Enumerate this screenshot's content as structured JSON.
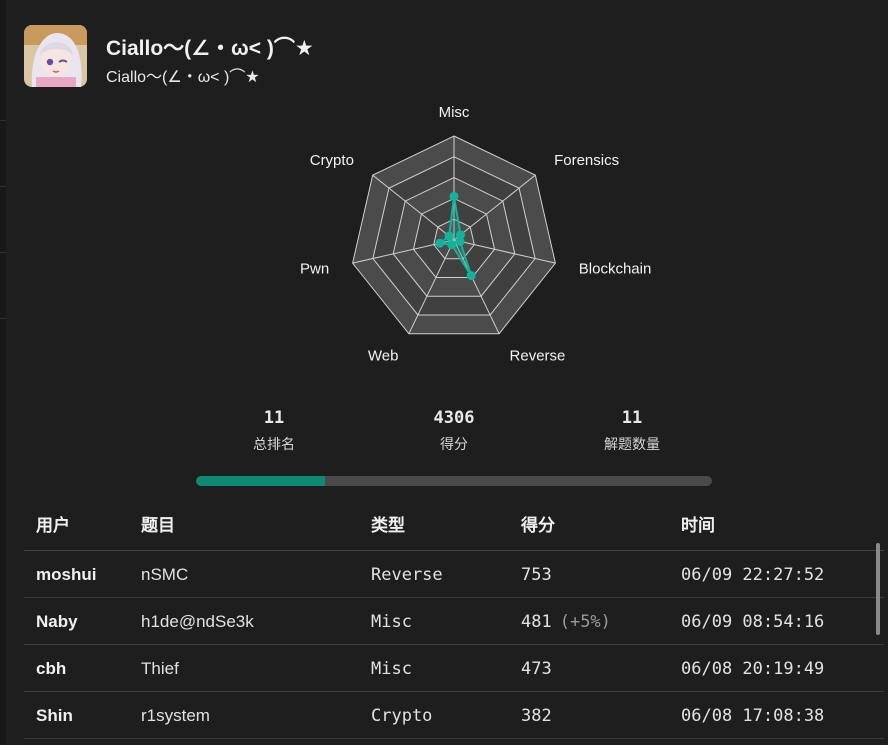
{
  "user": {
    "name": "Ciallo～(∠・ω< )⌒★",
    "subtitle": "Ciallo～(∠・ω< )⌒★"
  },
  "radar": {
    "axes": [
      "Misc",
      "Forensics",
      "Blockchain",
      "Reverse",
      "Web",
      "Pwn",
      "Crypto"
    ],
    "values": [
      0.42,
      0.08,
      0.06,
      0.38,
      0.05,
      0.14,
      0.06
    ],
    "accent": "#11b39a"
  },
  "stats": {
    "rank": {
      "value": "11",
      "label": "总排名"
    },
    "score": {
      "value": "4306",
      "label": "得分"
    },
    "solved": {
      "value": "11",
      "label": "解题数量"
    }
  },
  "progress": {
    "percent": 25
  },
  "table": {
    "headers": {
      "user": "用户",
      "challenge": "题目",
      "type": "类型",
      "score": "得分",
      "time": "时间"
    },
    "rows": [
      {
        "user": "moshui",
        "challenge": "nSMC",
        "type": "Reverse",
        "score": "753",
        "bonus": "",
        "time": "06/09 22:27:52"
      },
      {
        "user": "Naby",
        "challenge": "h1de@ndSe3k",
        "type": "Misc",
        "score": "481",
        "bonus": "(+5%)",
        "time": "06/09 08:54:16"
      },
      {
        "user": "cbh",
        "challenge": "Thief",
        "type": "Misc",
        "score": "473",
        "bonus": "",
        "time": "06/08 20:19:49"
      },
      {
        "user": "Shin",
        "challenge": "r1system",
        "type": "Crypto",
        "score": "382",
        "bonus": "",
        "time": "06/08 17:08:38"
      }
    ]
  }
}
